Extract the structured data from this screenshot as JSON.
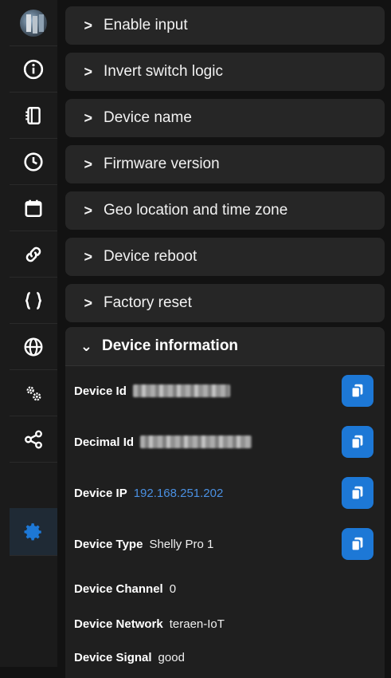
{
  "sidebar": {
    "items": [
      {
        "name": "avatar"
      },
      {
        "name": "info-icon"
      },
      {
        "name": "device-icon"
      },
      {
        "name": "clock-icon"
      },
      {
        "name": "calendar-icon"
      },
      {
        "name": "link-icon"
      },
      {
        "name": "code-braces-icon"
      },
      {
        "name": "globe-icon"
      },
      {
        "name": "settings-gears-icon"
      },
      {
        "name": "share-icon"
      },
      {
        "name": "gear-icon",
        "active": true
      }
    ],
    "active_color": "#1d78d6"
  },
  "accordion": {
    "collapsed": [
      {
        "label": "Enable input"
      },
      {
        "label": "Invert switch logic"
      },
      {
        "label": "Device name"
      },
      {
        "label": "Firmware version"
      },
      {
        "label": "Geo location and time zone"
      },
      {
        "label": "Device reboot"
      },
      {
        "label": "Factory reset"
      }
    ],
    "expanded": {
      "label": "Device information",
      "rows": [
        {
          "key": "Device Id",
          "value": ""
        },
        {
          "key": "Decimal Id",
          "value": ""
        },
        {
          "key": "Device IP",
          "value": "192.168.251.202"
        },
        {
          "key": "Device Type",
          "value": "Shelly Pro 1"
        },
        {
          "key": "Device Channel",
          "value": "0"
        },
        {
          "key": "Device Network",
          "value": "teraen-IoT"
        },
        {
          "key": "Device Signal",
          "value": "good"
        }
      ]
    }
  },
  "colors": {
    "link": "#4a90e2",
    "copy_button": "#1d78d6"
  }
}
